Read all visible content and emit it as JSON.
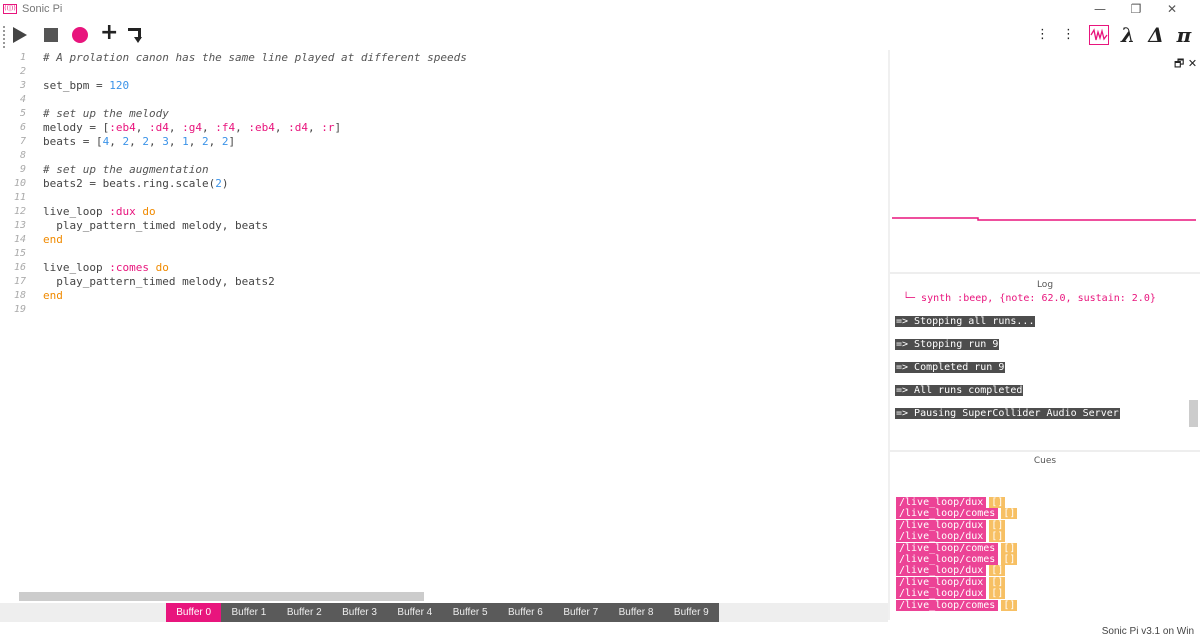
{
  "window": {
    "title": "Sonic Pi",
    "logo_text": "((|))",
    "controls": {
      "minimize": "—",
      "restore": "❐",
      "close": "✕"
    }
  },
  "toolbar": {
    "left_icons": [
      "play-icon",
      "stop-icon",
      "record-icon",
      "new-icon",
      "step-out-icon"
    ],
    "right_icons": [
      "info-icon",
      "prefs-icon",
      "scope-icon",
      "lambda-icon",
      "delta-icon",
      "pi-icon"
    ],
    "info_glyph": "⋮",
    "prefs_glyph": "⋮",
    "lambda_glyph": "λ",
    "delta_glyph": "Δ",
    "pi_glyph": "π",
    "accent": "#e8157d"
  },
  "editor": {
    "line_numbers": [
      "1",
      "2",
      "3",
      "4",
      "5",
      "6",
      "7",
      "8",
      "9",
      "10",
      "11",
      "12",
      "13",
      "14",
      "15",
      "16",
      "17",
      "18",
      "19"
    ],
    "lines": [
      [
        {
          "t": "# A prolation canon has the same line played at different speeds",
          "c": "comment"
        }
      ],
      [],
      [
        {
          "t": "set_bpm = ",
          "c": "plain"
        },
        {
          "t": "120",
          "c": "num"
        }
      ],
      [],
      [
        {
          "t": "# set up the melody",
          "c": "comment"
        }
      ],
      [
        {
          "t": "melody = [",
          "c": "plain"
        },
        {
          "t": ":eb4",
          "c": "sym"
        },
        {
          "t": ", ",
          "c": "plain"
        },
        {
          "t": ":d4",
          "c": "sym"
        },
        {
          "t": ", ",
          "c": "plain"
        },
        {
          "t": ":g4",
          "c": "sym"
        },
        {
          "t": ", ",
          "c": "plain"
        },
        {
          "t": ":f4",
          "c": "sym"
        },
        {
          "t": ", ",
          "c": "plain"
        },
        {
          "t": ":eb4",
          "c": "sym"
        },
        {
          "t": ", ",
          "c": "plain"
        },
        {
          "t": ":d4",
          "c": "sym"
        },
        {
          "t": ", ",
          "c": "plain"
        },
        {
          "t": ":r",
          "c": "sym"
        },
        {
          "t": "]",
          "c": "plain"
        }
      ],
      [
        {
          "t": "beats = [",
          "c": "plain"
        },
        {
          "t": "4",
          "c": "num"
        },
        {
          "t": ", ",
          "c": "plain"
        },
        {
          "t": "2",
          "c": "num"
        },
        {
          "t": ", ",
          "c": "plain"
        },
        {
          "t": "2",
          "c": "num"
        },
        {
          "t": ", ",
          "c": "plain"
        },
        {
          "t": "3",
          "c": "num"
        },
        {
          "t": ", ",
          "c": "plain"
        },
        {
          "t": "1",
          "c": "num"
        },
        {
          "t": ", ",
          "c": "plain"
        },
        {
          "t": "2",
          "c": "num"
        },
        {
          "t": ", ",
          "c": "plain"
        },
        {
          "t": "2",
          "c": "num"
        },
        {
          "t": "]",
          "c": "plain"
        }
      ],
      [],
      [
        {
          "t": "# set up the augmentation",
          "c": "comment"
        }
      ],
      [
        {
          "t": "beats2 = beats.ring.scale(",
          "c": "plain"
        },
        {
          "t": "2",
          "c": "num"
        },
        {
          "t": ")",
          "c": "plain"
        }
      ],
      [],
      [
        {
          "t": "live_loop ",
          "c": "plain"
        },
        {
          "t": ":dux",
          "c": "sym"
        },
        {
          "t": " ",
          "c": "plain"
        },
        {
          "t": "do",
          "c": "kw"
        }
      ],
      [
        {
          "t": "  play_pattern_timed melody, beats",
          "c": "plain"
        }
      ],
      [
        {
          "t": "end",
          "c": "kw"
        }
      ],
      [],
      [
        {
          "t": "live_loop ",
          "c": "plain"
        },
        {
          "t": ":comes",
          "c": "sym"
        },
        {
          "t": " ",
          "c": "plain"
        },
        {
          "t": "do",
          "c": "kw"
        }
      ],
      [
        {
          "t": "  play_pattern_timed melody, beats2",
          "c": "plain"
        }
      ],
      [
        {
          "t": "end",
          "c": "kw"
        }
      ],
      []
    ]
  },
  "buffers": {
    "tabs": [
      "Buffer 0",
      "Buffer 1",
      "Buffer 2",
      "Buffer 3",
      "Buffer 4",
      "Buffer 5",
      "Buffer 6",
      "Buffer 7",
      "Buffer 8",
      "Buffer 9"
    ],
    "active_index": 0
  },
  "scope": {
    "float_glyph": "🗗 ✕",
    "line_color": "#e8157d"
  },
  "log": {
    "title": "Log",
    "synth_line": "└─ synth :beep, {note: 62.0, sustain: 2.0}",
    "entries": [
      "=> Stopping all runs...",
      "=> Stopping run 9",
      "=> Completed run 9",
      "=> All runs completed",
      "=> Pausing SuperCollider Audio Server"
    ]
  },
  "cues": {
    "title": "Cues",
    "items": [
      {
        "path": "/live_loop/dux",
        "val": "[]"
      },
      {
        "path": "/live_loop/comes",
        "val": "[]"
      },
      {
        "path": "/live_loop/dux",
        "val": "[]"
      },
      {
        "path": "/live_loop/dux",
        "val": "[]"
      },
      {
        "path": "/live_loop/comes",
        "val": "[]"
      },
      {
        "path": "/live_loop/comes",
        "val": "[]"
      },
      {
        "path": "/live_loop/dux",
        "val": "[]"
      },
      {
        "path": "/live_loop/dux",
        "val": "[]"
      },
      {
        "path": "/live_loop/dux",
        "val": "[]"
      },
      {
        "path": "/live_loop/comes",
        "val": "[]"
      }
    ]
  },
  "status": {
    "text": "Sonic Pi v3.1 on Win"
  }
}
